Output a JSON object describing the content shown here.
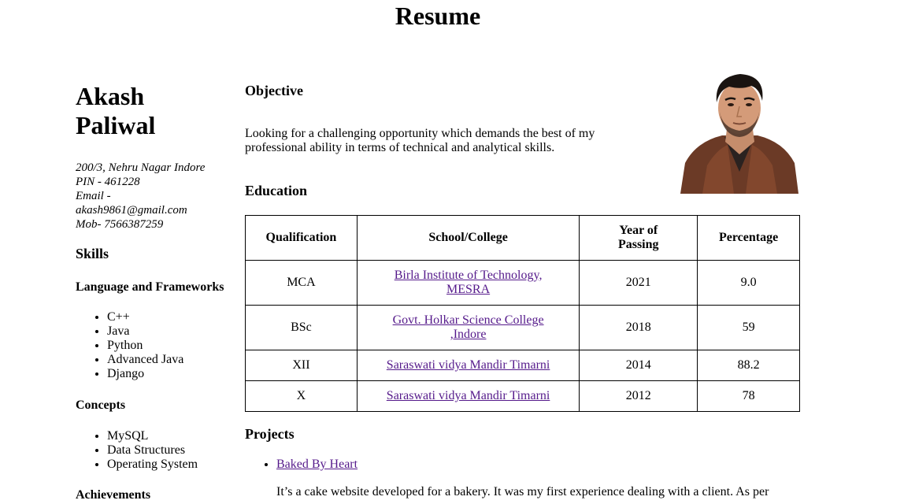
{
  "page": {
    "title": "Resume"
  },
  "profile": {
    "name_line1": "Akash",
    "name_line2": "Paliwal",
    "address": "200/3, Nehru Nagar Indore",
    "pin": "PIN - 461228",
    "email_label": "Email -",
    "email": "akash9861@gmail.com",
    "mobile": "Mob- 7566387259"
  },
  "skills": {
    "heading": "Skills",
    "languages_heading": "Language and Frameworks",
    "languages": [
      "C++",
      "Java",
      "Python",
      "Advanced Java",
      "Django"
    ],
    "concepts_heading": "Concepts",
    "concepts": [
      "MySQL",
      "Data Structures",
      "Operating System"
    ],
    "achievements_heading": "Achievements"
  },
  "objective": {
    "heading": "Objective",
    "text": "Looking for a challenging opportunity which demands the best of my professional ability in terms of technical and analytical skills."
  },
  "education": {
    "heading": "Education",
    "columns": [
      "Qualification",
      "School/College",
      "Year of Passing",
      "Percentage"
    ],
    "rows": [
      {
        "qualification": "MCA",
        "school": "Birla Institute of Technology, MESRA",
        "year": "2021",
        "percentage": "9.0"
      },
      {
        "qualification": "BSc",
        "school": "Govt. Holkar Science College ,Indore",
        "year": "2018",
        "percentage": "59"
      },
      {
        "qualification": "XII",
        "school": "Saraswati vidya Mandir Timarni",
        "year": "2014",
        "percentage": "88.2"
      },
      {
        "qualification": "X",
        "school": "Saraswati vidya Mandir Timarni",
        "year": "2012",
        "percentage": "78"
      }
    ]
  },
  "projects": {
    "heading": "Projects",
    "items": [
      {
        "title": "Baked By Heart",
        "description": "It’s a cake website developed for a bakery. It was my first experience dealing with a client. As per"
      }
    ]
  },
  "icons": {
    "photo": "profile-photo"
  }
}
